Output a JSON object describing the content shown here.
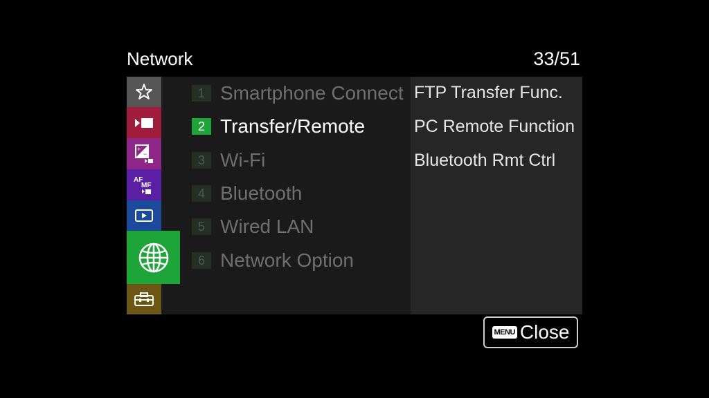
{
  "header": {
    "title": "Network",
    "page_counter": "33/51"
  },
  "sidebar": {
    "tabs": [
      {
        "name": "favorites",
        "icon": "star-icon",
        "color": "#555555"
      },
      {
        "name": "shooting",
        "icon": "camera-movie-icon",
        "color": "#a01c3c"
      },
      {
        "name": "exposure-color",
        "icon": "exposure-icon",
        "color": "#8e2787"
      },
      {
        "name": "focus",
        "icon": "af-mf-icon",
        "color": "#5b1fa3"
      },
      {
        "name": "playback",
        "icon": "playback-icon",
        "color": "#1b4a9a"
      },
      {
        "name": "network",
        "icon": "globe-icon",
        "color": "#1ea53a",
        "active": true
      },
      {
        "name": "setup",
        "icon": "toolbox-icon",
        "color": "#6b5613"
      }
    ]
  },
  "menu": {
    "items": [
      {
        "num": "1",
        "label": "Smartphone Connect"
      },
      {
        "num": "2",
        "label": "Transfer/Remote",
        "active": true
      },
      {
        "num": "3",
        "label": "Wi-Fi"
      },
      {
        "num": "4",
        "label": "Bluetooth"
      },
      {
        "num": "5",
        "label": "Wired LAN"
      },
      {
        "num": "6",
        "label": "Network Option"
      }
    ]
  },
  "submenu": {
    "items": [
      "FTP Transfer Func.",
      "PC Remote Function",
      "Bluetooth Rmt Ctrl"
    ]
  },
  "footer": {
    "menu_key": "MENU",
    "close_label": "Close"
  },
  "colors": {
    "accent": "#1ea53a",
    "background": "#000000",
    "panel": "#1a1a1a",
    "subpanel": "#262626"
  }
}
